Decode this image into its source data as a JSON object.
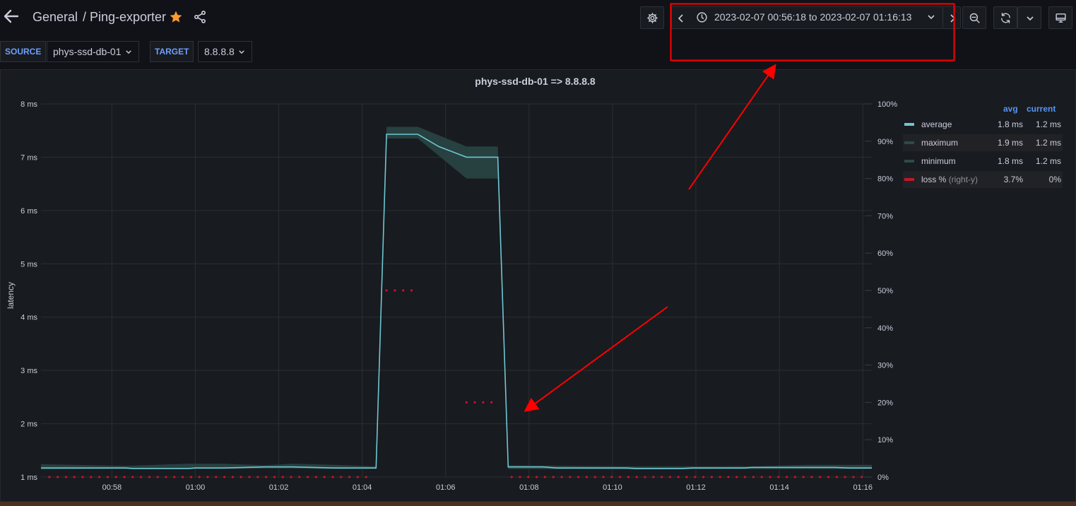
{
  "header": {
    "breadcrumb_folder": "General",
    "breadcrumb_dashboard": "/ Ping-exporter",
    "time_range": "2023-02-07 00:56:18 to 2023-02-07 01:16:13"
  },
  "icons": {
    "back": "arrow-left-icon",
    "star": "star-icon",
    "share": "share-icon",
    "settings": "gear-icon",
    "clock": "clock-icon",
    "zoom_out": "zoom-out-icon",
    "refresh": "refresh-icon",
    "tv": "monitor-icon"
  },
  "variables": {
    "source_label": "SOURCE",
    "source_value": "phys-ssd-db-01",
    "target_label": "TARGET",
    "target_value": "8.8.8.8"
  },
  "panel": {
    "title": "phys-ssd-db-01 => 8.8.8.8"
  },
  "legend": {
    "header_avg": "avg",
    "header_current": "current",
    "rows": [
      {
        "name": "average",
        "suffix": "",
        "avg": "1.8 ms",
        "current": "1.2 ms",
        "color": "#6ec6d4"
      },
      {
        "name": "maximum",
        "suffix": "",
        "avg": "1.9 ms",
        "current": "1.2 ms",
        "color": "#2d4a4a"
      },
      {
        "name": "minimum",
        "suffix": "",
        "avg": "1.8 ms",
        "current": "1.2 ms",
        "color": "#2d4a4a"
      },
      {
        "name": "loss %",
        "suffix": "(right-y)",
        "avg": "3.7%",
        "current": "0%",
        "color": "#c4162a"
      }
    ]
  },
  "colors": {
    "average_line": "#6ec6d4",
    "band_fill": "#2a4747",
    "loss": "#c4162a",
    "annotation": "#ff0000",
    "star": "#ff9830"
  },
  "chart_data": {
    "type": "line",
    "title": "phys-ssd-db-01 => 8.8.8.8",
    "ylabel": "latency",
    "y_unit": "ms",
    "ylim": [
      1,
      8
    ],
    "y_ticks": [
      "1 ms",
      "2 ms",
      "3 ms",
      "4 ms",
      "5 ms",
      "6 ms",
      "7 ms",
      "8 ms"
    ],
    "y2lim": [
      0,
      100
    ],
    "y2_ticks": [
      "0%",
      "10%",
      "20%",
      "30%",
      "40%",
      "50%",
      "60%",
      "70%",
      "80%",
      "90%",
      "100%"
    ],
    "x_range": [
      "00:56:18",
      "01:16:13"
    ],
    "x_ticks": [
      "00:58",
      "01:00",
      "01:02",
      "01:04",
      "01:06",
      "01:08",
      "01:10",
      "01:12",
      "01:14",
      "01:16"
    ],
    "grid": true,
    "legend_position": "right",
    "series": [
      {
        "name": "average",
        "x": [
          "00:56:18",
          "00:58:20",
          "00:58:30",
          "00:59:50",
          "01:00:00",
          "01:00:40",
          "01:01:40",
          "01:02:20",
          "01:03:20",
          "01:04:20",
          "01:04:35",
          "01:05:20",
          "01:05:50",
          "01:06:30",
          "01:07:15",
          "01:07:30",
          "01:08:20",
          "01:08:40",
          "01:10:20",
          "01:10:35",
          "01:11:40",
          "01:11:55",
          "01:13:10",
          "01:13:20",
          "01:15:20",
          "01:15:40",
          "01:16:13"
        ],
        "values": [
          1.17,
          1.17,
          1.16,
          1.16,
          1.17,
          1.17,
          1.19,
          1.19,
          1.17,
          1.17,
          7.43,
          7.43,
          7.2,
          7.0,
          7.0,
          1.19,
          1.19,
          1.17,
          1.17,
          1.16,
          1.16,
          1.17,
          1.17,
          1.18,
          1.18,
          1.17,
          1.17
        ]
      },
      {
        "name": "maximum",
        "x": [
          "00:56:18",
          "00:58:20",
          "00:59:50",
          "01:00:40",
          "01:01:40",
          "01:02:20",
          "01:03:20",
          "01:04:20",
          "01:04:35",
          "01:05:20",
          "01:06:30",
          "01:07:15",
          "01:07:30",
          "01:10:20",
          "01:13:20",
          "01:14:40",
          "01:16:13"
        ],
        "values": [
          1.24,
          1.21,
          1.25,
          1.25,
          1.22,
          1.25,
          1.23,
          1.2,
          7.57,
          7.57,
          7.2,
          7.2,
          1.22,
          1.2,
          1.2,
          1.23,
          1.23
        ]
      },
      {
        "name": "minimum",
        "x": [
          "00:56:18",
          "00:58:20",
          "00:59:50",
          "01:00:40",
          "01:01:40",
          "01:02:20",
          "01:03:20",
          "01:04:20",
          "01:04:35",
          "01:05:20",
          "01:06:30",
          "01:07:15",
          "01:07:30",
          "01:10:20",
          "01:13:20",
          "01:14:40",
          "01:16:13"
        ],
        "values": [
          1.14,
          1.15,
          1.15,
          1.15,
          1.16,
          1.16,
          1.15,
          1.15,
          7.35,
          7.35,
          6.6,
          6.6,
          1.15,
          1.14,
          1.15,
          1.15,
          1.15
        ]
      },
      {
        "name": "loss %",
        "axis": "right",
        "segments": [
          {
            "from": "00:56:30",
            "to": "01:04:15",
            "value": 0
          },
          {
            "from": "01:04:35",
            "to": "01:05:15",
            "value": 50
          },
          {
            "from": "01:06:30",
            "to": "01:07:15",
            "value": 20
          },
          {
            "from": "01:07:35",
            "to": "01:16:00",
            "value": 0
          }
        ]
      }
    ]
  }
}
